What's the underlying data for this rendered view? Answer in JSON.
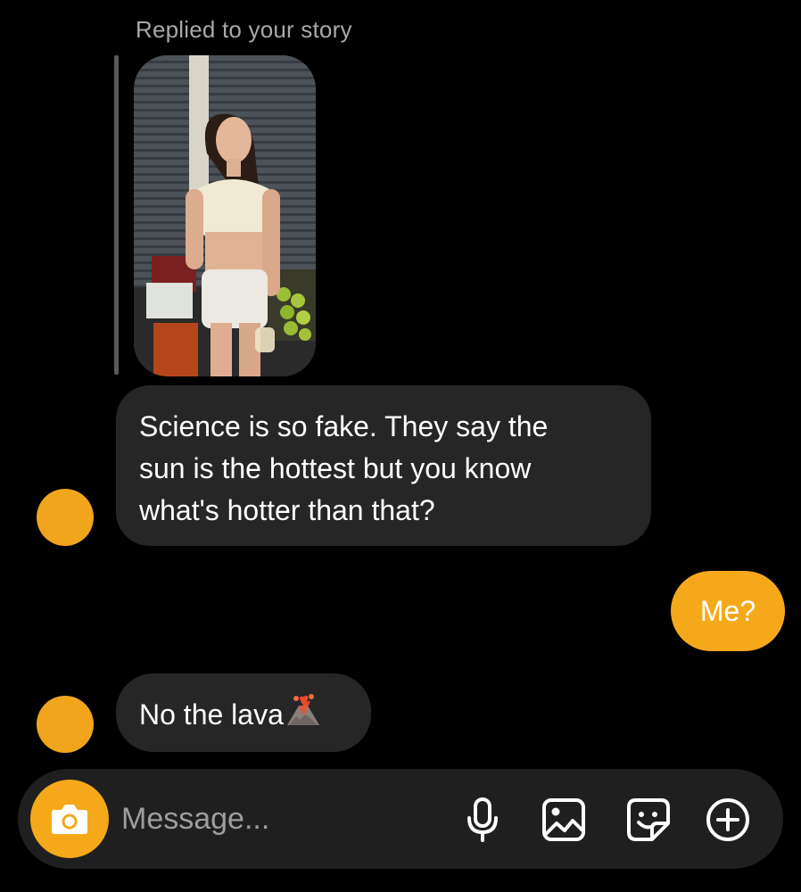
{
  "story_reply": {
    "label": "Replied to your story",
    "thumbnail_icon": "story-photo"
  },
  "messages": [
    {
      "sender": "other",
      "text": "Science is so fake. They say the sun is the hottest but you know what's hotter than that?",
      "lines": [
        "Science is so fake. They say the",
        "sun is the hottest but you know",
        "what's hotter than that?"
      ]
    },
    {
      "sender": "me",
      "text": "Me?"
    },
    {
      "sender": "other",
      "text": "No the lava",
      "emoji": "volcano-icon"
    }
  ],
  "composer": {
    "placeholder": "Message...",
    "icons": [
      "camera-icon",
      "microphone-icon",
      "gallery-icon",
      "sticker-icon",
      "plus-circle-icon"
    ]
  },
  "colors": {
    "background": "#000000",
    "incoming_bubble": "#262626",
    "outgoing_bubble": "#f5a91a",
    "avatar": "#f0a51c",
    "composer_bg": "#1f1f1f",
    "secondary_text": "#a8a8a8"
  }
}
